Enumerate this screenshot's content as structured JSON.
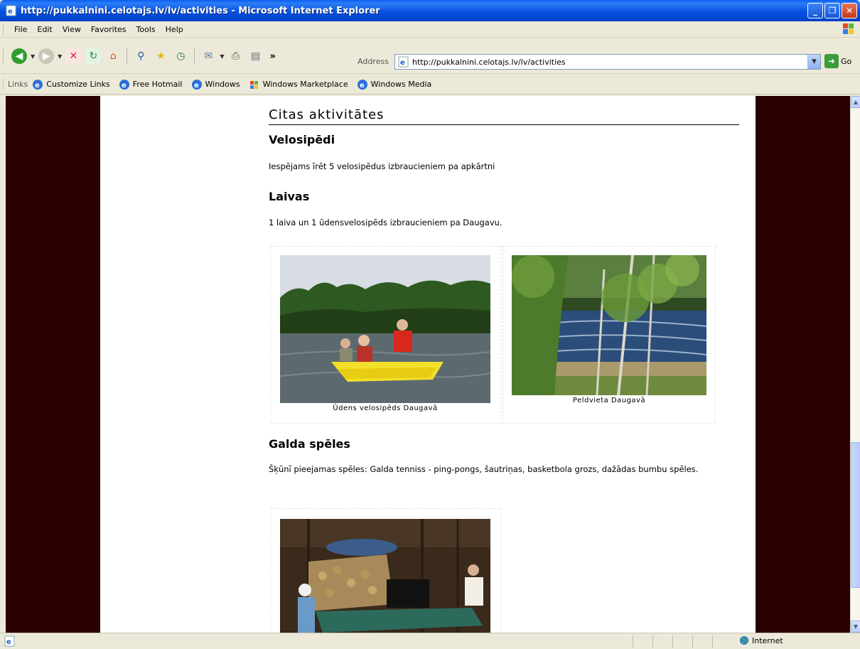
{
  "window": {
    "title": "http://pukkalnini.celotajs.lv/lv/activities - Microsoft Internet Explorer"
  },
  "menu": [
    "File",
    "Edit",
    "View",
    "Favorites",
    "Tools",
    "Help"
  ],
  "toolbar": {
    "address_label": "Address",
    "address_value": "http://pukkalnini.celotajs.lv/lv/activities",
    "go_label": "Go",
    "chevron": "»"
  },
  "links": {
    "label": "Links",
    "items": [
      "Customize Links",
      "Free Hotmail",
      "Windows",
      "Windows Marketplace",
      "Windows Media"
    ]
  },
  "page": {
    "title": "Citas aktivitātes",
    "sections": [
      {
        "heading": "Velosipēdi",
        "text": "Iespējams īrēt 5 velosipēdus izbraucieniem pa apkārtni"
      },
      {
        "heading": "Laivas",
        "text": "1 laiva un 1 ūdensvelosipēds izbraucieniem pa Daugavu."
      },
      {
        "heading": "Galda spēles",
        "text": "Šķūnī pieejamas spēles: Galda tenniss - ping-pongs, šautriņas, basketbola grozs, dažādas bumbu spēles."
      }
    ],
    "captions": [
      "Ūdens velosipēds Daugavā",
      "Peldvieta Daugavā"
    ]
  },
  "status": {
    "zone": "Internet"
  },
  "colors": {
    "titlebar": "#0752e0",
    "page_bg": "#2a0000",
    "content_bg": "#ffffff"
  }
}
